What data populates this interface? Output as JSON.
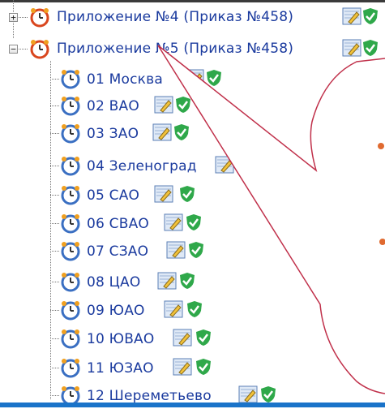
{
  "tree": {
    "nodes": [
      {
        "label": "Приложение №4 (Приказ №458)",
        "toggle": "+",
        "level": "group"
      },
      {
        "label": "Приложение №5 (Приказ №458)",
        "toggle": "−",
        "level": "group"
      },
      {
        "label": "01 Москва",
        "level": "child"
      },
      {
        "label": "02 ВАО",
        "level": "child"
      },
      {
        "label": "03 ЗАО",
        "level": "child"
      },
      {
        "label": "04 Зеленоград",
        "level": "child"
      },
      {
        "label": "05 САО",
        "level": "child"
      },
      {
        "label": "06 СВАО",
        "level": "child"
      },
      {
        "label": "07 СЗАО",
        "level": "child"
      },
      {
        "label": "08 ЦАО",
        "level": "child"
      },
      {
        "label": "09 ЮАО",
        "level": "child"
      },
      {
        "label": "10 ЮВАО",
        "level": "child"
      },
      {
        "label": "11 ЮЗАО",
        "level": "child"
      },
      {
        "label": "12 Шереметьево",
        "level": "child"
      }
    ]
  },
  "colors": {
    "link": "#1a3a9e",
    "callout_outline": "#c0304a",
    "check_green": "#2fa84a",
    "bottom_bar": "#1a73c9"
  },
  "icons": {
    "group": "alarm-clock-red-icon",
    "child": "alarm-clock-blue-icon",
    "edit": "edit-pencil-icon",
    "ok": "shield-check-icon"
  }
}
